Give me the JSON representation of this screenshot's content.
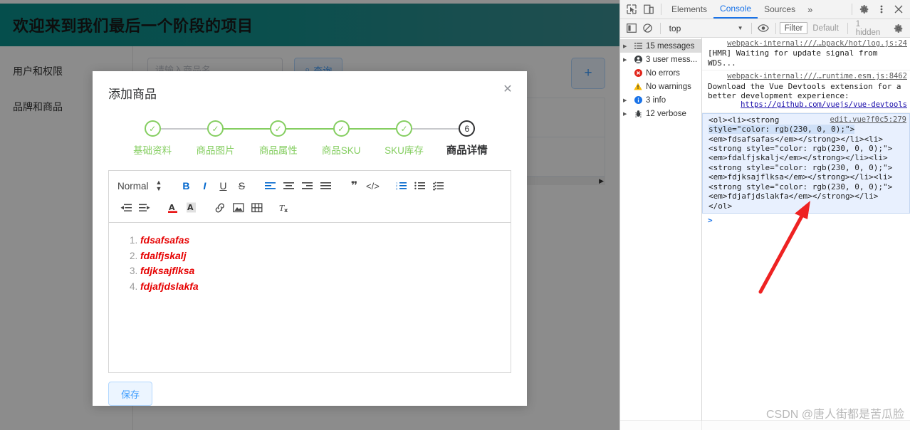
{
  "page": {
    "header_title": "欢迎来到我们最后一个阶段的项目",
    "nav": [
      {
        "label": "用户和权限",
        "chevron": "chevron-down-icon"
      },
      {
        "label": "品牌和商品",
        "chevron": ""
      }
    ],
    "search": {
      "placeholder": "请输入商品名",
      "value": "",
      "button_label": "查询",
      "button_icon": "search-icon"
    },
    "add_button_label": "+"
  },
  "modal": {
    "title": "添加商品",
    "close_label": "✕",
    "steps": [
      {
        "label": "基础资料",
        "mark": "✓",
        "state": "done"
      },
      {
        "label": "商品图片",
        "mark": "✓",
        "state": "done"
      },
      {
        "label": "商品属性",
        "mark": "✓",
        "state": "done"
      },
      {
        "label": "商品SKU",
        "mark": "✓",
        "state": "done"
      },
      {
        "label": "SKU库存",
        "mark": "✓",
        "state": "done"
      },
      {
        "label": "商品详情",
        "mark": "6",
        "state": "active"
      }
    ],
    "toolbar": {
      "format_label": "Normal",
      "row1": [
        {
          "name": "bold-icon",
          "glyph": "B",
          "active": true,
          "style": "bold"
        },
        {
          "name": "italic-icon",
          "glyph": "I",
          "active": true,
          "style": "italic"
        },
        {
          "name": "underline-icon",
          "glyph": "U",
          "active": false,
          "style": "underline"
        },
        {
          "name": "strikethrough-icon",
          "glyph": "S",
          "active": false,
          "style": "strike"
        },
        {
          "name": "align-left-icon",
          "glyph": "≡",
          "active": true,
          "style": ""
        },
        {
          "name": "align-center-icon",
          "glyph": "≡",
          "active": false,
          "style": ""
        },
        {
          "name": "align-right-icon",
          "glyph": "≡",
          "active": false,
          "style": ""
        },
        {
          "name": "align-justify-icon",
          "glyph": "≡",
          "active": false,
          "style": ""
        },
        {
          "name": "blockquote-icon",
          "glyph": "❞",
          "active": false,
          "style": ""
        },
        {
          "name": "code-block-icon",
          "glyph": "‹›",
          "active": false,
          "style": ""
        },
        {
          "name": "ordered-list-icon",
          "glyph": "≔",
          "active": true,
          "style": ""
        },
        {
          "name": "bullet-list-icon",
          "glyph": "☰",
          "active": false,
          "style": ""
        },
        {
          "name": "check-list-icon",
          "glyph": "☑",
          "active": false,
          "style": ""
        }
      ],
      "row2": [
        {
          "name": "outdent-icon",
          "glyph": "⇤",
          "active": false
        },
        {
          "name": "indent-icon",
          "glyph": "⇥",
          "active": false
        },
        {
          "name": "text-color-icon",
          "glyph": "A",
          "active": false
        },
        {
          "name": "background-color-icon",
          "glyph": "A",
          "active": false
        },
        {
          "name": "link-icon",
          "glyph": "🔗",
          "active": false
        },
        {
          "name": "image-icon",
          "glyph": "▣",
          "active": false
        },
        {
          "name": "video-icon",
          "glyph": "▤",
          "active": false
        },
        {
          "name": "clear-format-icon",
          "glyph": "Tx",
          "active": false
        }
      ]
    },
    "editor_items": [
      "fdsafsafas",
      "fdalfjskalj",
      "fdjksajflksa",
      "fdjafjdslakfa"
    ],
    "editor_text_color": "#e60000",
    "save_label": "保存"
  },
  "devtools": {
    "toolbar": {
      "inspect_icon": "inspect-element-icon",
      "device_icon": "device-toolbar-icon",
      "tabs": [
        {
          "label": "Elements",
          "selected": false
        },
        {
          "label": "Console",
          "selected": true
        },
        {
          "label": "Sources",
          "selected": false
        }
      ],
      "more_tabs": "»",
      "settings_icon": "gear-icon",
      "kebab_icon": "more-options-icon",
      "close_icon": "close-icon"
    },
    "console_bar": {
      "sidebar_toggle_icon": "console-sidebar-icon",
      "clear_icon": "clear-console-icon",
      "context": "top",
      "context_caret": "▼",
      "eye_icon": "live-expression-icon",
      "filter_placeholder": "Filter",
      "level": "Default",
      "hidden_count": "1 hidden",
      "settings_icon": "gear-icon"
    },
    "sidebar": [
      {
        "label": "15 messages",
        "icon": "messages-icon",
        "expandable": true,
        "selected": true
      },
      {
        "label": "3 user mess...",
        "icon": "user-message-icon",
        "expandable": true,
        "selected": false
      },
      {
        "label": "No errors",
        "icon": "error-icon",
        "expandable": false,
        "selected": false
      },
      {
        "label": "No warnings",
        "icon": "warning-icon",
        "expandable": false,
        "selected": false
      },
      {
        "label": "3 info",
        "icon": "info-icon",
        "expandable": true,
        "selected": false
      },
      {
        "label": "12 verbose",
        "icon": "verbose-icon",
        "expandable": true,
        "selected": false
      }
    ],
    "logs": [
      {
        "source": "webpack-internal:///…bpack/hot/log.js:24",
        "text": "[HMR] Waiting for update signal from WDS..."
      },
      {
        "source": "webpack-internal:///…runtime.esm.js:8462",
        "text": "Download the Vue Devtools extension for a better development experience:",
        "link": "https://github.com/vuejs/vue-devtools"
      }
    ],
    "selected_log": {
      "source": "edit.vue?f0c5:279",
      "lines": [
        "<ol><li><strong",
        "style=\"color: rgb(230, 0, 0);\">",
        "<em>fdsafsafas</em></strong></li><li>",
        "<strong style=\"color: rgb(230, 0, 0);\">",
        "<em>fdalfjskalj</em></strong></li><li>",
        "<strong style=\"color: rgb(230, 0, 0);\">",
        "<em>fdjksajflksa</em></strong></li><li>",
        "<strong style=\"color: rgb(230, 0, 0);\">",
        "<em>fdjafjdslakfa</em></strong></li>",
        "</ol>"
      ]
    },
    "prompt": ">"
  },
  "annotation": {
    "arrow_color": "#ee2222",
    "arrow_name": "red-pointer-arrow"
  },
  "watermark": "CSDN @唐人街都是苦瓜脸"
}
